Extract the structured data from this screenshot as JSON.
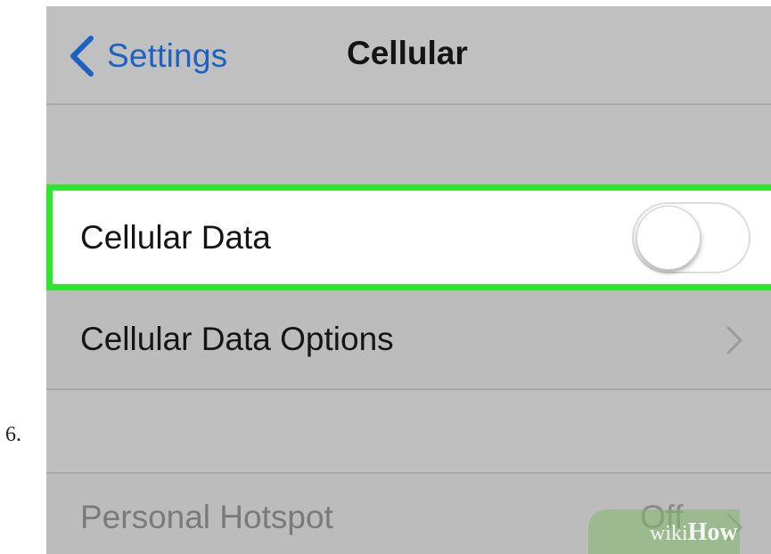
{
  "step": {
    "number": "6."
  },
  "nav": {
    "back_label": "Settings",
    "title": "Cellular"
  },
  "rows": {
    "cellular_data": {
      "label": "Cellular Data",
      "toggle_on": false
    },
    "cellular_data_options": {
      "label": "Cellular Data Options"
    },
    "personal_hotspot": {
      "label": "Personal Hotspot",
      "value": "Off"
    }
  },
  "watermark": {
    "wiki": "wiki",
    "how": "How"
  },
  "colors": {
    "accent": "#1c62c2",
    "highlight": "#2ee62e",
    "screen_bg": "#bdbdbd"
  },
  "icons": {
    "back": "chevron-left-icon",
    "disclosure": "chevron-right-icon"
  }
}
